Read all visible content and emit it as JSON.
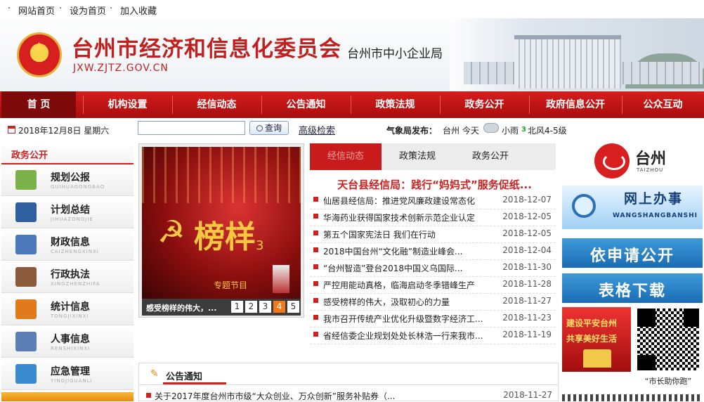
{
  "topbar": {
    "links": [
      "网站首页",
      "设为首页",
      "加入收藏"
    ]
  },
  "banner": {
    "title": "台州市经济和信息化委员会",
    "subtitle": "台州市中小企业局",
    "url": "JXW.ZJTZ.GOV.CN"
  },
  "nav": {
    "items": [
      "首 页",
      "机构设置",
      "经信动态",
      "公告通知",
      "政策法规",
      "政务公开",
      "政府信息公开",
      "公众互动"
    ]
  },
  "infobar": {
    "date": "2018年12月8日 星期六",
    "search_placeholder": "",
    "search_button": "查询",
    "advanced_search": "高级检索",
    "weather_label": "气象局发布：",
    "weather_city": "台州 今天",
    "weather_cond": "小雨",
    "weather_num": "3",
    "weather_wind": "北风4-5级"
  },
  "sidebar": {
    "title": "政务公开",
    "items": [
      {
        "label": "规划公报",
        "pinyin": "GUIHUAGONGBAO",
        "color": "#7bb04a"
      },
      {
        "label": "计划总结",
        "pinyin": "JIHUAZONGJIE",
        "color": "#2f5f9e"
      },
      {
        "label": "财政信息",
        "pinyin": "CAIZHENGXINXI",
        "color": "#4a78b8"
      },
      {
        "label": "行政执法",
        "pinyin": "XINGZHENZHIFA",
        "color": "#8a5a3a"
      },
      {
        "label": "统计信息",
        "pinyin": "TONGJIXINXI",
        "color": "#e07a1a"
      },
      {
        "label": "人事信息",
        "pinyin": "RENSHIXINXI",
        "color": "#5b7fb5"
      },
      {
        "label": "应急管理",
        "pinyin": "YINGJIGUANLI",
        "color": "#3a8ad0"
      }
    ]
  },
  "slideshow": {
    "image_text": "榜样",
    "image_num": "3",
    "image_sub": "专题节目",
    "caption": "感受榜样的伟大，...",
    "pages": [
      "1",
      "2",
      "3",
      "4",
      "5"
    ],
    "active_page": 4
  },
  "news": {
    "tabs": [
      "经信动态",
      "政策法规",
      "政务公开"
    ],
    "headline": "天台县经信局：践行“妈妈式”服务促纸...",
    "items": [
      {
        "title": "仙居县经信局：推进党风廉政建设常态化",
        "date": "2018-12-07"
      },
      {
        "title": "华海药业获得国家技术创新示范企业认定",
        "date": "2018-12-05"
      },
      {
        "title": "第五个国家宪法日 我们在行动",
        "date": "2018-12-05"
      },
      {
        "title": "2018中国台州“文化融”制造业峰会...",
        "date": "2018-12-04"
      },
      {
        "title": "“台州智造”登台2018中国义乌国际...",
        "date": "2018-11-30"
      },
      {
        "title": "严控用能动真格，临海启动冬季错峰生产",
        "date": "2018-11-28"
      },
      {
        "title": "感受榜样的伟大，汲取初心的力量",
        "date": "2018-11-27"
      },
      {
        "title": "我市召开传统产业优化升级暨数字经济工...",
        "date": "2018-11-23"
      },
      {
        "title": "省经信委企业规划处处长林浩一行来我市...",
        "date": "2018-11-19"
      }
    ]
  },
  "notice": {
    "title": "公告通知",
    "items": [
      {
        "title": "关于2017年度台州市市级“大众创业、万众创新”服务补贴券（...",
        "date": "2018-11-27"
      }
    ]
  },
  "right": {
    "logo_text": "台州",
    "logo_en": "TAIZHOU",
    "wsbs": "网上办事",
    "wsbs_en": "WANGSHANGBANSHI",
    "ysq": "依申请公开",
    "bgxz": "表格下载",
    "promo_l1": "建设平安台州",
    "promo_l2": "共享美好生活",
    "qr_caption": "“市长助你跑”"
  },
  "colors": {
    "brand_red": "#c81b1b",
    "nav_dark": "#7d0909",
    "accent_blue": "#1a6cb5",
    "accent_orange": "#f07a1a"
  }
}
